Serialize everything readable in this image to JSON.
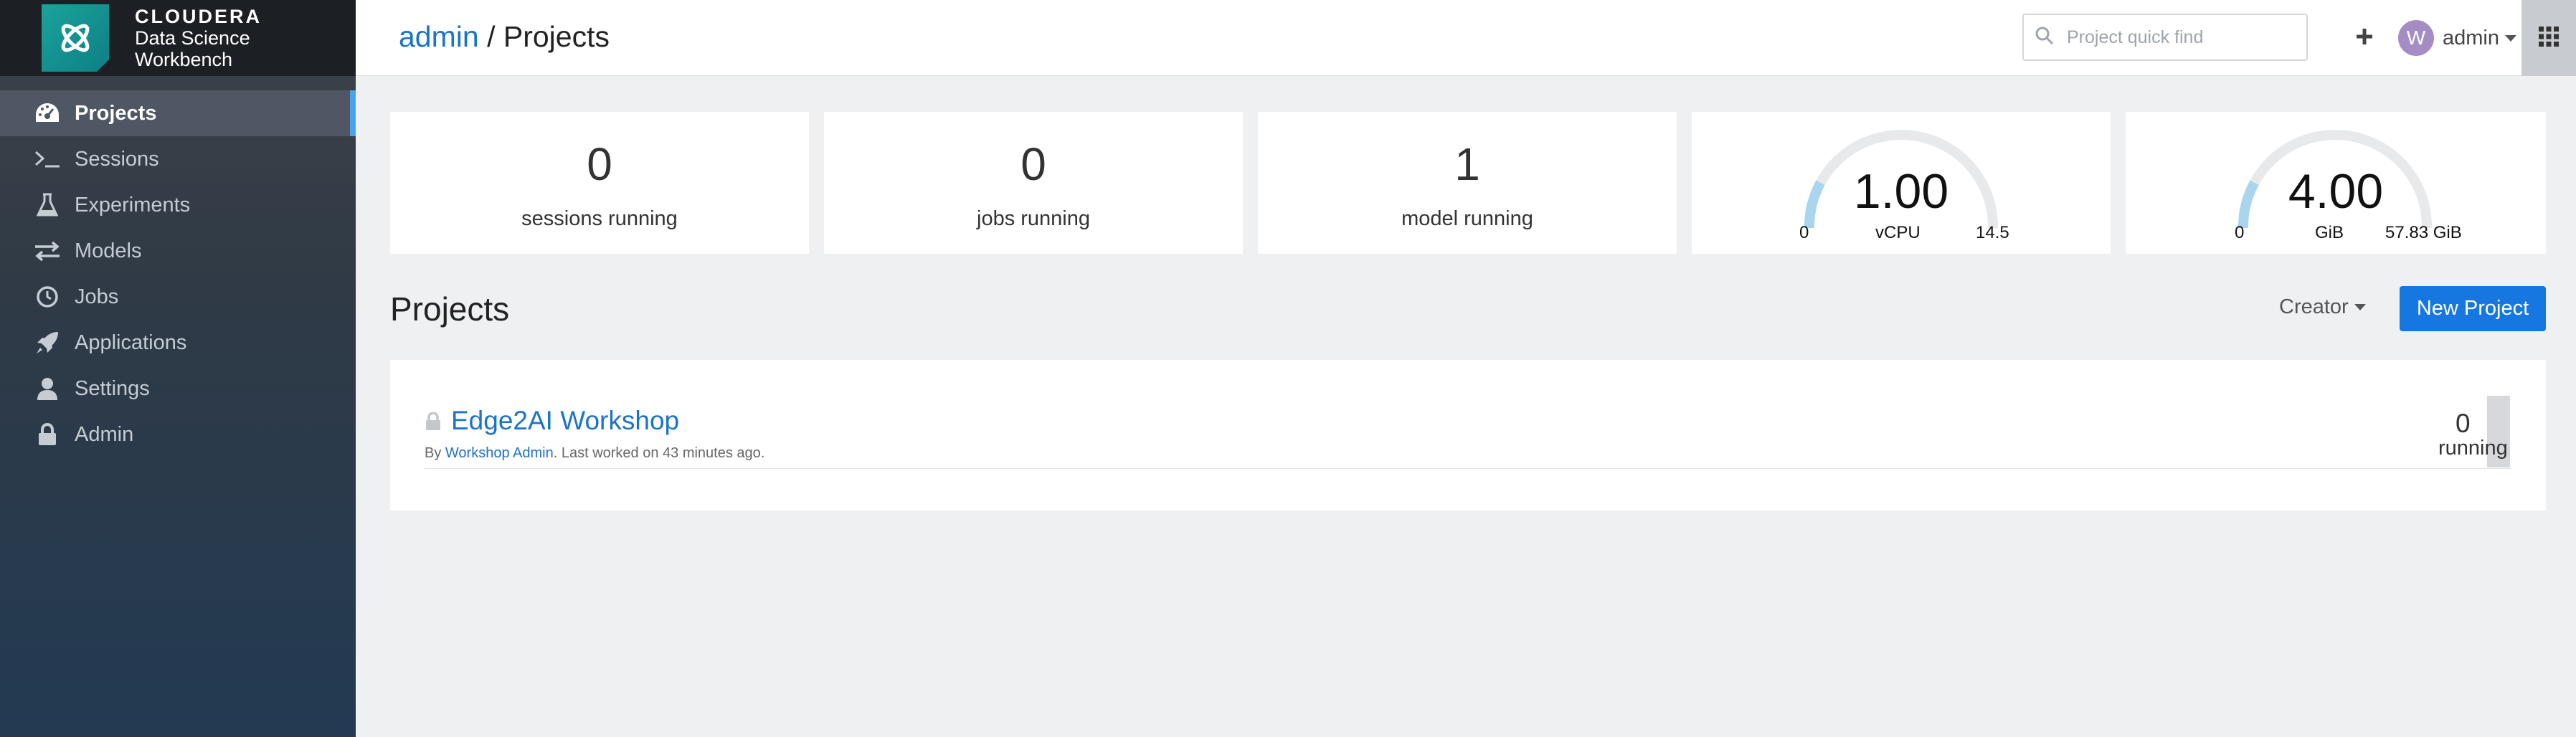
{
  "brand": {
    "company": "CLOUDERA",
    "product_line1": "Data Science",
    "product_line2": "Workbench"
  },
  "sidebar": {
    "items": [
      {
        "label": "Projects",
        "icon": "dashboard-icon",
        "active": true
      },
      {
        "label": "Sessions",
        "icon": "terminal-icon"
      },
      {
        "label": "Experiments",
        "icon": "flask-icon"
      },
      {
        "label": "Models",
        "icon": "arrows-icon"
      },
      {
        "label": "Jobs",
        "icon": "clock-icon"
      },
      {
        "label": "Applications",
        "icon": "rocket-icon"
      },
      {
        "label": "Settings",
        "icon": "user-icon"
      },
      {
        "label": "Admin",
        "icon": "lock-icon"
      }
    ]
  },
  "header": {
    "breadcrumb_link": "admin",
    "breadcrumb_sep": " / ",
    "breadcrumb_current": "Projects",
    "search_placeholder": "Project quick find",
    "user_initial": "W",
    "username": "admin"
  },
  "stats": [
    {
      "value": "0",
      "label": "sessions running"
    },
    {
      "value": "0",
      "label": "jobs running"
    },
    {
      "value": "1",
      "label": "model running"
    }
  ],
  "gauges": [
    {
      "value": "1.00",
      "min": "0",
      "unit": "vCPU",
      "max": "14.5",
      "fraction": 0.069
    },
    {
      "value": "4.00",
      "min": "0",
      "unit": "GiB",
      "max": "57.83 GiB",
      "fraction": 0.069
    }
  ],
  "colors": {
    "accent": "#1677e0",
    "gauge_fill": "#a9d6ee",
    "gauge_track": "#e8e9eb",
    "gauge_tip": "#7cb342"
  },
  "projects_section": {
    "title": "Projects",
    "filter_label": "Creator",
    "new_button": "New Project",
    "items": [
      {
        "name": "Edge2AI Workshop",
        "by_prefix": "By ",
        "creator": "Workshop Admin",
        "last_worked": ". Last worked on 43 minutes ago.",
        "running_count": "0",
        "running_label": "running"
      }
    ]
  }
}
